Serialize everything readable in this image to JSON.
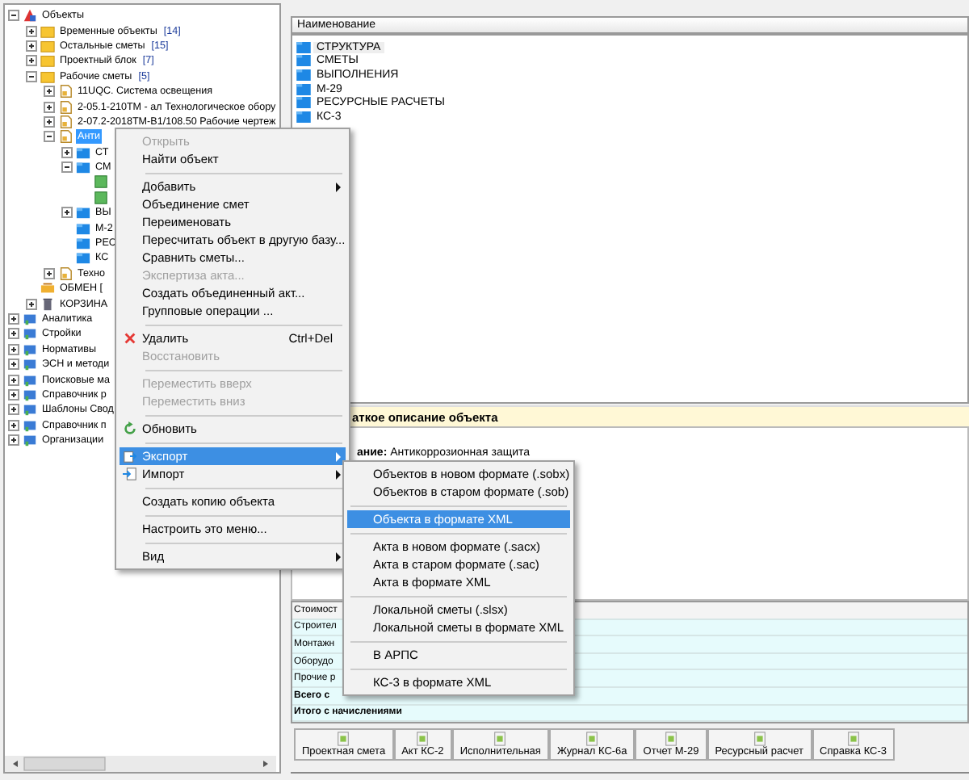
{
  "tree": [
    {
      "label": "Объекты",
      "kind": "root",
      "expanded": true,
      "selected": false,
      "children": [
        {
          "label": "Временные объекты",
          "count": "[14]",
          "kind": "folder",
          "expanded": false,
          "selected": false
        },
        {
          "label": "Остальные сметы",
          "count": "[15]",
          "kind": "folder",
          "expanded": false,
          "selected": false
        },
        {
          "label": "Проектный блок",
          "count": "[7]",
          "kind": "folder",
          "expanded": false,
          "selected": false
        },
        {
          "label": "Рабочие сметы",
          "count": "[5]",
          "kind": "folder",
          "expanded": true,
          "selected": false,
          "children": [
            {
              "label": "11UQC. Система освещения",
              "kind": "object",
              "expanded": false,
              "selected": false
            },
            {
              "label": "2-05.1-210ТМ - ал  Технологическое обору",
              "kind": "object",
              "expanded": false,
              "selected": false
            },
            {
              "label": "2-07.2-2018ТМ-В1/108.50  Рабочие чертеж",
              "kind": "object",
              "expanded": false,
              "selected": false
            },
            {
              "label": "Анти",
              "kind": "object",
              "expanded": true,
              "selected": true,
              "children": [
                {
                  "label": "СТ",
                  "kind": "section",
                  "expanded": false,
                  "selected": false
                },
                {
                  "label": "СМ",
                  "kind": "section",
                  "expanded": true,
                  "selected": false,
                  "children": [
                    {
                      "kind": "sheet",
                      "selected": false
                    },
                    {
                      "kind": "sheet",
                      "selected": false
                    }
                  ]
                },
                {
                  "label": "ВЫ",
                  "kind": "section",
                  "expanded": false,
                  "selected": false
                },
                {
                  "label": "М-2",
                  "kind": "section",
                  "selected": false
                },
                {
                  "label": "РЕС",
                  "kind": "section",
                  "selected": false
                },
                {
                  "label": "КС",
                  "kind": "section",
                  "selected": false
                }
              ]
            },
            {
              "label": "Техно",
              "kind": "object",
              "expanded": false,
              "selected": false
            }
          ]
        },
        {
          "label": "ОБМЕН [",
          "kind": "exchange",
          "selected": false
        },
        {
          "label": "КОРЗИНА",
          "kind": "trash",
          "expanded": false,
          "selected": false
        }
      ]
    },
    {
      "label": "Аналитика",
      "kind": "category",
      "expanded": false,
      "selected": false
    },
    {
      "label": "Стройки",
      "kind": "category",
      "expanded": false,
      "selected": false
    },
    {
      "label": "Нормативы",
      "kind": "category",
      "expanded": false,
      "selected": false
    },
    {
      "label": "ЭСН и методи",
      "kind": "category",
      "expanded": false,
      "selected": false
    },
    {
      "label": "Поисковые ма",
      "kind": "category",
      "expanded": false,
      "selected": false
    },
    {
      "label": "Справочник р",
      "kind": "category",
      "expanded": false,
      "selected": false
    },
    {
      "label": "Шаблоны Свод",
      "kind": "category",
      "expanded": false,
      "selected": false
    },
    {
      "label": "Справочник п",
      "kind": "category",
      "expanded": false,
      "selected": false
    },
    {
      "label": "Организации",
      "kind": "category",
      "expanded": false,
      "selected": false
    }
  ],
  "list": {
    "header": "Наименование",
    "items": [
      {
        "label": "СТРУКТУРА",
        "selected": true
      },
      {
        "label": "СМЕТЫ",
        "selected": false
      },
      {
        "label": "ВЫПОЛНЕНИЯ",
        "selected": false
      },
      {
        "label": "М-29",
        "selected": false
      },
      {
        "label": "РЕСУРСНЫЕ РАСЧЕТЫ",
        "selected": false
      },
      {
        "label": "КС-3",
        "selected": false
      }
    ]
  },
  "description": {
    "title": "аткое описание объекта",
    "text": "**ание:** Антикоррозионная защита"
  },
  "cost_table": [
    {
      "label": "Стоимост",
      "kind": "header"
    },
    {
      "label": "Строител",
      "kind": "row"
    },
    {
      "label": "Монтажн",
      "kind": "row"
    },
    {
      "label": "Оборудо",
      "kind": "row"
    },
    {
      "label": "Прочие р",
      "kind": "row"
    },
    {
      "label": "Всего с",
      "kind": "total"
    },
    {
      "label": "Итого с начислениями",
      "kind": "total"
    }
  ],
  "toolbar": [
    {
      "label": "Проектная смета"
    },
    {
      "label": "Акт КС-2"
    },
    {
      "label": "Исполнительная"
    },
    {
      "label": "Журнал КС-6а"
    },
    {
      "label": "Отчет М-29"
    },
    {
      "label": "Ресурсный расчет"
    },
    {
      "label": "Справка КС-3"
    }
  ],
  "context_menu": [
    {
      "kind": "item",
      "label": "Открыть",
      "disabled": true,
      "selected": false,
      "submenu": false
    },
    {
      "kind": "item",
      "label": "Найти объект",
      "disabled": false,
      "selected": false,
      "submenu": false
    },
    {
      "kind": "separator"
    },
    {
      "kind": "item",
      "label": "Добавить",
      "disabled": false,
      "selected": false,
      "submenu": true
    },
    {
      "kind": "item",
      "label": "Объединение смет",
      "disabled": false,
      "selected": false,
      "submenu": false
    },
    {
      "kind": "item",
      "label": "Переименовать",
      "disabled": false,
      "selected": false,
      "submenu": false
    },
    {
      "kind": "item",
      "label": "Пересчитать объект в другую базу...",
      "disabled": false,
      "selected": false,
      "submenu": false
    },
    {
      "kind": "item",
      "label": "Сравнить сметы...",
      "disabled": false,
      "selected": false,
      "submenu": false
    },
    {
      "kind": "item",
      "label": "Экспертиза акта...",
      "disabled": true,
      "selected": false,
      "submenu": false
    },
    {
      "kind": "item",
      "label": "Создать объединенный акт...",
      "disabled": false,
      "selected": false,
      "submenu": false
    },
    {
      "kind": "item",
      "label": "Групповые операции ...",
      "disabled": false,
      "selected": false,
      "submenu": false
    },
    {
      "kind": "separator"
    },
    {
      "kind": "delete",
      "label": "Удалить",
      "shortcut": "Ctrl+Del",
      "disabled": false,
      "selected": false,
      "submenu": false
    },
    {
      "kind": "item",
      "label": "Восстановить",
      "disabled": true,
      "selected": false,
      "submenu": false
    },
    {
      "kind": "separator"
    },
    {
      "kind": "item",
      "label": "Переместить вверх",
      "disabled": true,
      "selected": false,
      "submenu": false
    },
    {
      "kind": "item",
      "label": "Переместить вниз",
      "disabled": true,
      "selected": false,
      "submenu": false
    },
    {
      "kind": "separator"
    },
    {
      "kind": "refresh",
      "label": "Обновить",
      "disabled": false,
      "selected": false,
      "submenu": false
    },
    {
      "kind": "separator"
    },
    {
      "kind": "export",
      "label": "Экспорт",
      "disabled": false,
      "selected": true,
      "submenu": true
    },
    {
      "kind": "import",
      "label": "Импорт",
      "disabled": false,
      "selected": false,
      "submenu": true
    },
    {
      "kind": "separator"
    },
    {
      "kind": "item",
      "label": "Создать копию объекта",
      "disabled": false,
      "selected": false,
      "submenu": false
    },
    {
      "kind": "separator"
    },
    {
      "kind": "item",
      "label": "Настроить это меню...",
      "disabled": false,
      "selected": false,
      "submenu": false
    },
    {
      "kind": "separator"
    },
    {
      "kind": "item",
      "label": "Вид",
      "disabled": false,
      "selected": false,
      "submenu": true
    }
  ],
  "export_menu": [
    {
      "kind": "item",
      "label": "Объектов в новом формате (.sobx)",
      "selected": false
    },
    {
      "kind": "item",
      "label": "Объектов в старом формате (.sob)",
      "selected": false
    },
    {
      "kind": "separator"
    },
    {
      "kind": "item",
      "label": "Объекта в формате XML",
      "selected": true
    },
    {
      "kind": "separator"
    },
    {
      "kind": "item",
      "label": "Акта в новом формате (.sacx)",
      "selected": false
    },
    {
      "kind": "item",
      "label": "Акта в старом формате (.sac)",
      "selected": false
    },
    {
      "kind": "item",
      "label": "Акта в формате XML",
      "selected": false
    },
    {
      "kind": "separator"
    },
    {
      "kind": "item",
      "label": "Локальной сметы (.slsx)",
      "selected": false
    },
    {
      "kind": "item",
      "label": "Локальной сметы в формате XML",
      "selected": false
    },
    {
      "kind": "separator"
    },
    {
      "kind": "item",
      "label": "В АРПС",
      "selected": false
    },
    {
      "kind": "separator"
    },
    {
      "kind": "item",
      "label": "КС-3 в формате XML",
      "selected": false
    }
  ]
}
